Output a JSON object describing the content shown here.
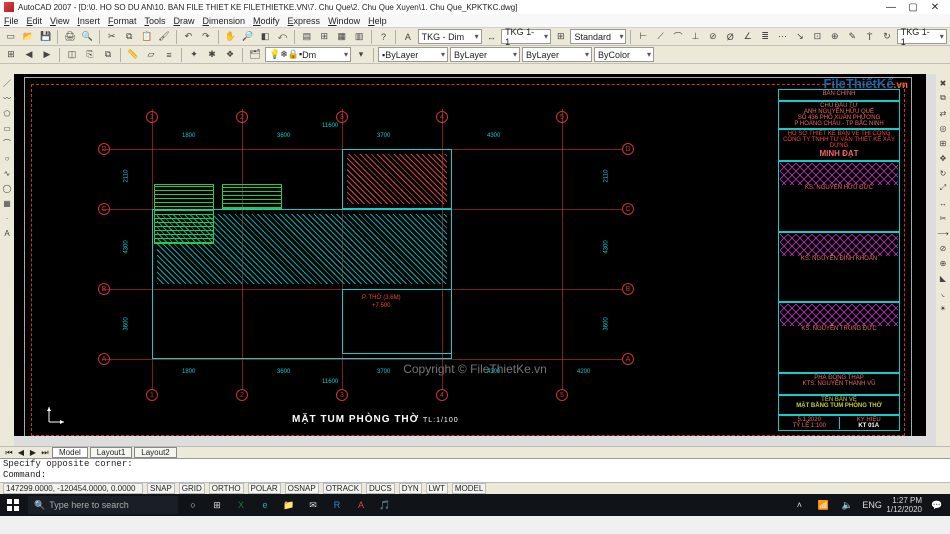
{
  "app_title": "AutoCAD 2007 - [D:\\0. HO SO DU AN\\10. BAN FILE THIET KE FILETHIETKE.VN\\7. Chu Que\\2. Chu Que Xuyen\\1. Chu Que_KPKTKC.dwg]",
  "menu": [
    "File",
    "Edit",
    "View",
    "Insert",
    "Format",
    "Tools",
    "Draw",
    "Dimension",
    "Modify",
    "Express",
    "Window",
    "Help"
  ],
  "toolbars": {
    "combo_style1": "TKG - Dim",
    "combo_style2": "TKG 1-1",
    "combo_style3": "Standard",
    "combo_style4": "TKG 1-1",
    "layer_dd": "Dm",
    "combo_bylayer1": "ByLayer",
    "combo_bylayer2": "ByLayer",
    "combo_bylayer3": "ByLayer",
    "combo_bycolor": "ByColor"
  },
  "watermark": {
    "file": "File",
    "thietke": "ThiếtKế",
    "vn": ".vn",
    "copyright": "Copyright © FileThietKe.vn"
  },
  "layout_tabs": {
    "nav": [
      "⏮",
      "◀",
      "▶",
      "⏭"
    ],
    "tabs": [
      "Model",
      "Layout1",
      "Layout2"
    ],
    "active": "Model"
  },
  "command_lines": [
    "Specify opposite corner:",
    "Command:"
  ],
  "status": {
    "coords": "147299.0000, -120454.0000, 0.0000",
    "toggles": [
      "SNAP",
      "GRID",
      "ORTHO",
      "POLAR",
      "OSNAP",
      "OTRACK",
      "DUCS",
      "DYN",
      "LWT",
      "MODEL"
    ]
  },
  "taskbar": {
    "search_placeholder": "Type here to search",
    "tray": {
      "lang": "ENG",
      "net": "📶",
      "vol": "🔈",
      "time": "1:27 PM",
      "date": "1/12/2020"
    }
  },
  "drawing": {
    "title": "MẶT TUM PHÒNG THỜ",
    "scale": "TL:1/100",
    "room_label": "P. THỜ (3.6M)",
    "room_elev": "+7.500",
    "grid_letters_left": [
      "D",
      "C",
      "B",
      "A"
    ],
    "grid_letters_right": [
      "D",
      "C",
      "B",
      "A"
    ],
    "grid_numbers_top": [
      "1",
      "2",
      "3",
      "4",
      "5"
    ],
    "grid_numbers_bottom": [
      "1",
      "2",
      "3",
      "4",
      "5"
    ],
    "dims_top_overall": "11600",
    "dims_top_seg": [
      "1800",
      "3600",
      "3700",
      "4300"
    ],
    "dims_bottom_overall": "11600",
    "dims_bottom_seg": [
      "1800",
      "3600",
      "3700",
      "4300",
      "4200"
    ],
    "dims_right_seg": [
      "2110",
      "4300",
      "3600"
    ],
    "dims_left_seg": [
      "3600",
      "4300",
      "2110"
    ],
    "titleblock": {
      "rows": [
        "BẢN CHÍNH",
        "CHỦ ĐẦU TƯ",
        "ANH NGUYỄN HỮU QUẾ",
        "SỐ 436 PHỐ XUÂN PHƯƠNG",
        "P HOÀNG CHÂU - TP BẮC NINH",
        "HỒ SƠ THIẾT KẾ BẢN VẼ THI CÔNG",
        "CÔNG TY TNHH TƯ VẤN THIẾT KẾ XÂY DỰNG",
        "MINH ĐẠT",
        "KS. NGUYỄN HỮU ĐỨC",
        "KS. NGUYỄN ĐÌNH KHOẢN",
        "KS. NGUYỄN TRUNG ĐỨC",
        "PHÁ ĐÔNG THÁP",
        "KTS. NGUYỄN THANH VŨ",
        "TÊN BẢN VẼ",
        "MẶT BẰNG TUM PHÒNG THỜ",
        "KÝ HIỆU",
        "KT 01A",
        "5.1.2020",
        "TỶ LỆ 1:100"
      ]
    }
  },
  "chart_data": null
}
